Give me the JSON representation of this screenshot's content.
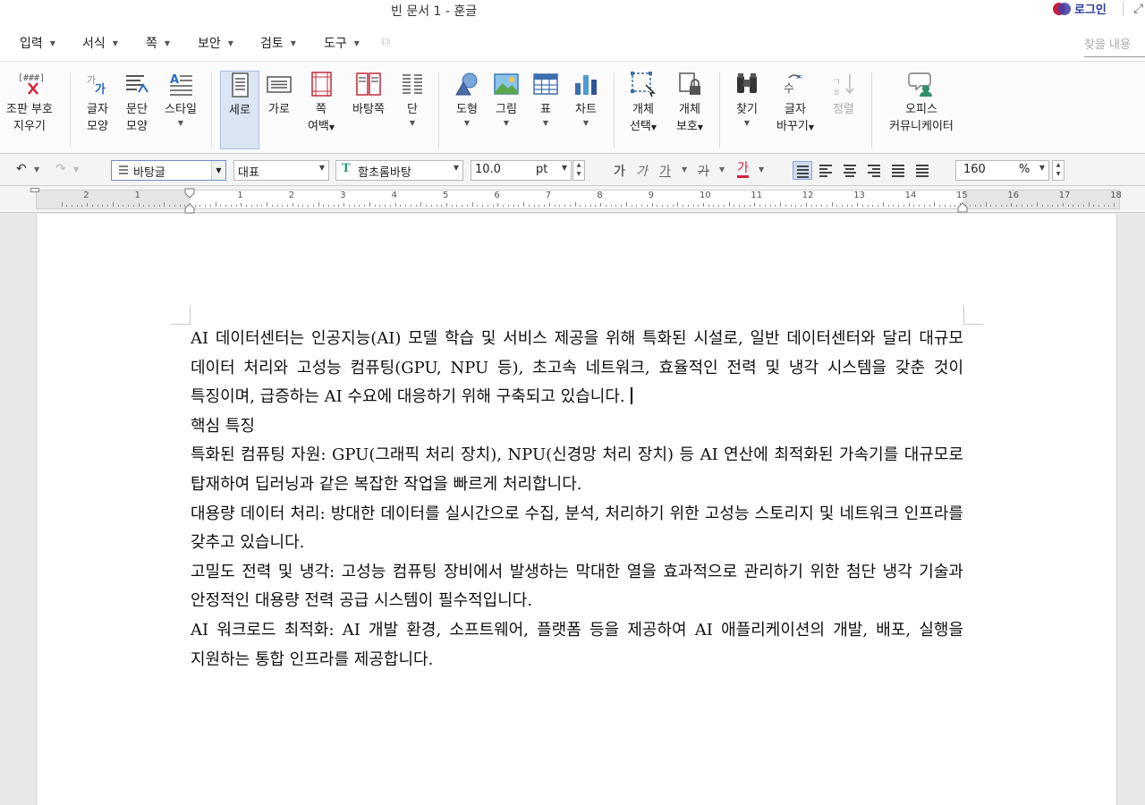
{
  "window": {
    "title": "빈 문서 1 - 훈글",
    "login_label": "로그인"
  },
  "menu": {
    "items": [
      "입력",
      "서식",
      "쪽",
      "보안",
      "검토",
      "도구"
    ],
    "search_placeholder": "찾을 내용"
  },
  "ribbon": {
    "clear_marks": [
      "조판 부호",
      "지우기"
    ],
    "char_shape": [
      "글자",
      "모양"
    ],
    "para_shape": [
      "문단",
      "모양"
    ],
    "style": "스타일",
    "portrait": "세로",
    "landscape": "가로",
    "page_margin": [
      "쪽",
      "여백"
    ],
    "background_page": "바탕쪽",
    "columns": "단",
    "shape": "도형",
    "picture": "그림",
    "table": "표",
    "chart": "차트",
    "object_select": [
      "개체",
      "선택"
    ],
    "object_protect": [
      "개체",
      "보호"
    ],
    "find": "찾기",
    "replace": [
      "글자",
      "바꾸기"
    ],
    "sort": "정렬",
    "office_communicator": [
      "오피스",
      "커뮤니케이터"
    ]
  },
  "format": {
    "style": "바탕글",
    "language": "대표",
    "font": "함초롬바탕",
    "font_icon": "T",
    "font_size": "10.0",
    "size_unit": "pt",
    "bold_glyph": "가",
    "italic_glyph": "가",
    "underline_glyph": "가",
    "strike_glyph": "가",
    "color_glyph": "가",
    "zoom": "160",
    "zoom_unit": "%"
  },
  "ruler": {
    "labels": [
      "2",
      "1",
      "",
      "1",
      "2",
      "3",
      "4",
      "5",
      "6",
      "7",
      "8",
      "9",
      "10",
      "11",
      "12",
      "13",
      "14",
      "15",
      "16",
      "17",
      "18"
    ]
  },
  "document": {
    "paragraphs": [
      "AI 데이터센터는 인공지능(AI) 모델 학습 및 서비스 제공을 위해 특화된 시설로, 일반 데이터센터와 달리 대규모 데이터 처리와 고성능 컴퓨팅(GPU, NPU 등), 초고속 네트워크, 효율적인 전력 및 냉각 시스템을 갖춘 것이 특징이며, 급증하는 AI 수요에 대응하기 위해 구축되고 있습니다.",
      "핵심 특징",
      "특화된 컴퓨팅 자원: GPU(그래픽 처리 장치), NPU(신경망 처리 장치) 등 AI 연산에 최적화된 가속기를 대규모로 탑재하여 딥러닝과 같은 복잡한 작업을 빠르게 처리합니다.",
      "대용량 데이터 처리: 방대한 데이터를 실시간으로 수집, 분석, 처리하기 위한 고성능 스토리지 및 네트워크 인프라를 갖추고 있습니다.",
      "고밀도 전력 및 냉각: 고성능 컴퓨팅 장비에서 발생하는 막대한 열을 효과적으로 관리하기 위한 첨단 냉각 기술과 안정적인 대용량 전력 공급 시스템이 필수적입니다.",
      "AI 워크로드 최적화: AI 개발 환경, 소프트웨어, 플랫폼 등을 제공하여 AI 애플리케이션의 개발, 배포, 실행을 지원하는 통합 인프라를 제공합니다."
    ]
  }
}
